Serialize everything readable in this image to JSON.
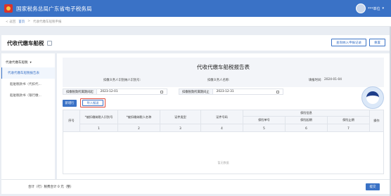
{
  "topbar": {
    "title": "国家税务总局广东省电子税务局",
    "user_name": "***单位"
  },
  "breadcrumb": {
    "back": "< 返回",
    "home": "首页",
    "sep": ">",
    "current": "代收代缴车船税申报"
  },
  "page": {
    "title": "代收代缴车船税",
    "actions": [
      "查询纳入申报记录",
      "重置"
    ]
  },
  "sidebar": {
    "group": "代收代缴车船税",
    "items": [
      "代收代缴车船税报告表",
      "船舶税款书（代扣代...",
      "船舶税款书（银行缴..."
    ]
  },
  "report": {
    "title": "代收代缴车船税报告表",
    "taxpayer_id_label": "扣缴义务人识别纳人识别号:",
    "taxpayer_name_label": "扣缴义务人名称:",
    "fill_date_label": "填报时间:",
    "fill_date": "2024-01-04"
  },
  "filters": {
    "from_label": "扣缴税款所属期间起",
    "from_value": "2023-12-01",
    "to_label": "扣缴税款所属期间止",
    "to_value": "2023-12-31"
  },
  "buttons": {
    "add": "新增行",
    "import": "导入报送"
  },
  "table": {
    "headers": {
      "seq": "序号",
      "col1": "*被扣缴纳税人识别号",
      "col2": "*被扣缴纳税人名称",
      "col3": "证件类型",
      "col4": "证件号码",
      "insurance": "保险信息",
      "ins_no": "保险单号",
      "ins_start": "保险起期",
      "ins_end": "保险止期",
      "op": "操作"
    },
    "numbers": [
      "1",
      "2",
      "3",
      "4",
      "5",
      "6",
      "7"
    ],
    "empty_text": "暂无数据"
  },
  "footer": {
    "summary": "合计（行）税费合计 0 元（整）",
    "submit": "提交"
  },
  "colors": {
    "primary": "#3a72c6",
    "highlight": "#e04a3a"
  }
}
